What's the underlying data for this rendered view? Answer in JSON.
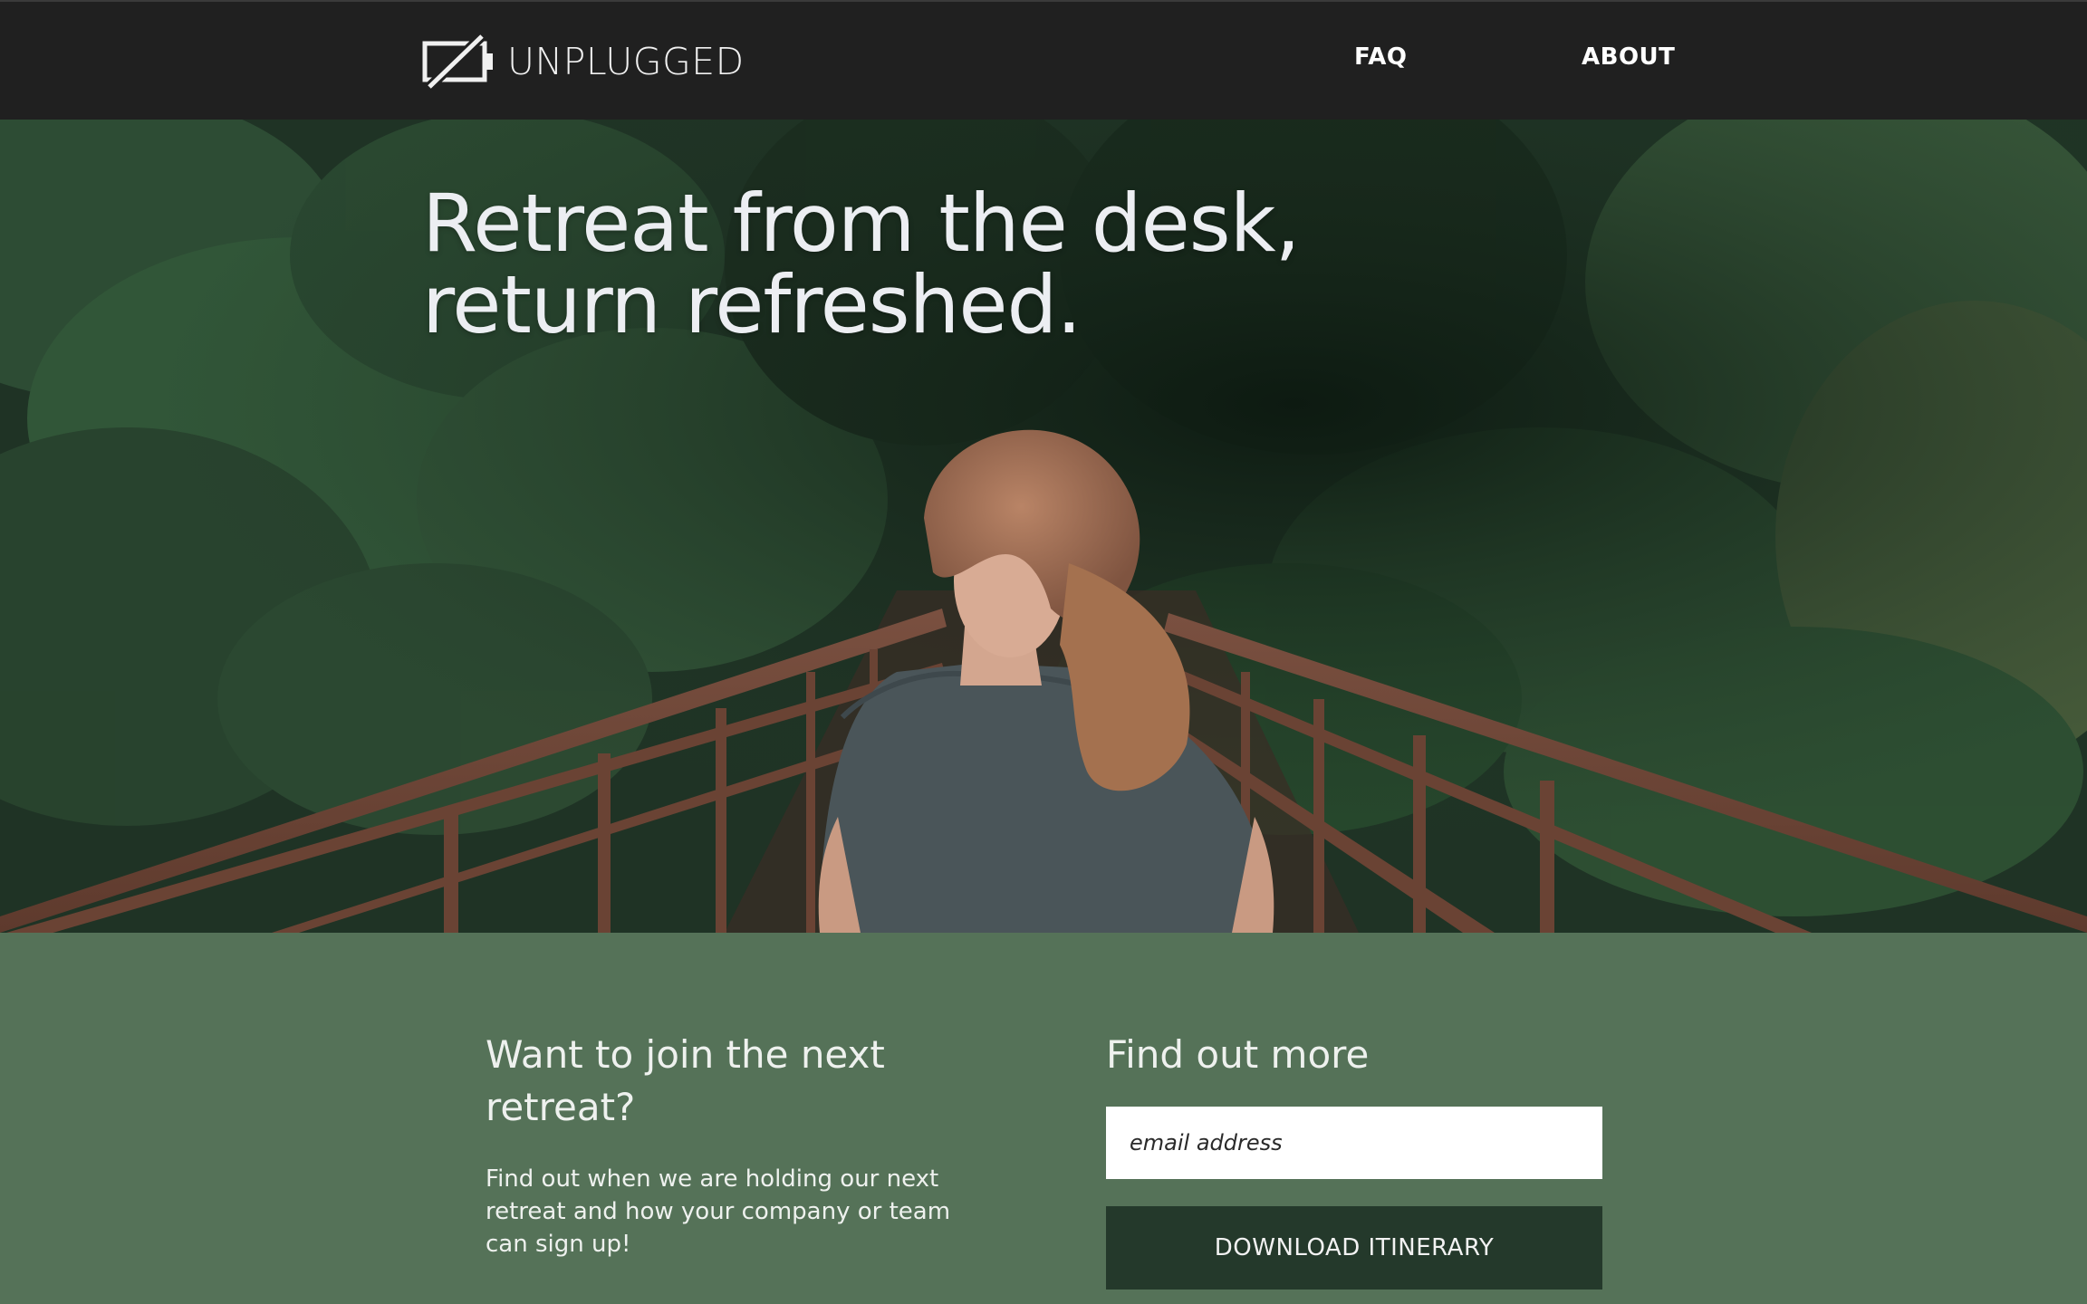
{
  "header": {
    "brand_name": "UNPLUGGED",
    "brand_icon": "battery-off-icon",
    "nav": [
      {
        "label": "FAQ"
      },
      {
        "label": "ABOUT"
      }
    ]
  },
  "hero": {
    "title_line1": "Retreat from the desk,",
    "title_line2": "return refreshed.",
    "image": "photo-woman-on-forest-bridge"
  },
  "signup": {
    "left_heading": "Want to join the next retreat?",
    "left_body": "Find out when we are holding our next retreat and how your company or team can sign up!",
    "right_heading": "Find out more",
    "email_placeholder": "email address",
    "email_value": "",
    "button_label": "DOWNLOAD ITINERARY"
  },
  "colors": {
    "header_bg": "#202020",
    "section_bg": "#557258",
    "button_bg": "#24392b",
    "text_light": "#eef1ee"
  }
}
